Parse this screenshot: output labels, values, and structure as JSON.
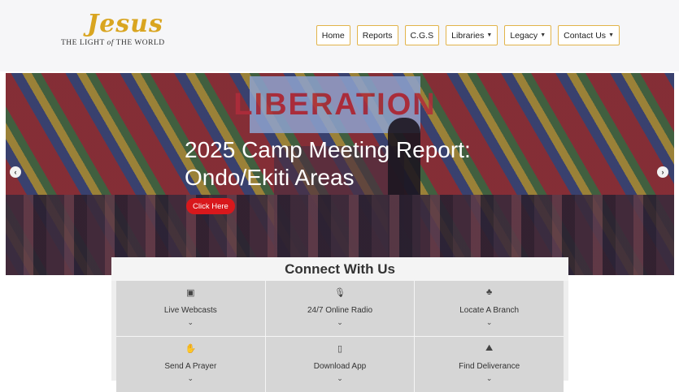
{
  "logo": {
    "script": "Jesus",
    "tagline_pre": "THE LIGHT",
    "tagline_of": "of",
    "tagline_post": "THE WORLD"
  },
  "nav": {
    "items": [
      {
        "label": "Home",
        "dropdown": false
      },
      {
        "label": "Reports",
        "dropdown": false
      },
      {
        "label": "C.G.S",
        "dropdown": false
      },
      {
        "label": "Libraries",
        "dropdown": true
      },
      {
        "label": "Legacy",
        "dropdown": true
      },
      {
        "label": "Contact Us",
        "dropdown": true
      }
    ],
    "caret": "▼"
  },
  "hero": {
    "banner_text": "LIBERATION",
    "title": "2025 Camp Meeting Report: Ondo/Ekiti Areas",
    "button_label": "Click Here",
    "prev_icon": "‹",
    "next_icon": "›"
  },
  "connect": {
    "title": "Connect With Us",
    "chevron": "⌄",
    "items": [
      {
        "label": "Live Webcasts",
        "icon": "youtube-icon",
        "glyph": "▣"
      },
      {
        "label": "24/7 Online Radio",
        "icon": "microphone-icon",
        "glyph": "🎙"
      },
      {
        "label": "Locate A Branch",
        "icon": "sitemap-icon",
        "glyph": "♣"
      },
      {
        "label": "Send A Prayer",
        "icon": "praying-hands-icon",
        "glyph": "✋"
      },
      {
        "label": "Download App",
        "icon": "mobile-icon",
        "glyph": "▯"
      },
      {
        "label": "Find Deliverance",
        "icon": "hands-icon",
        "glyph": "⛰"
      }
    ]
  }
}
